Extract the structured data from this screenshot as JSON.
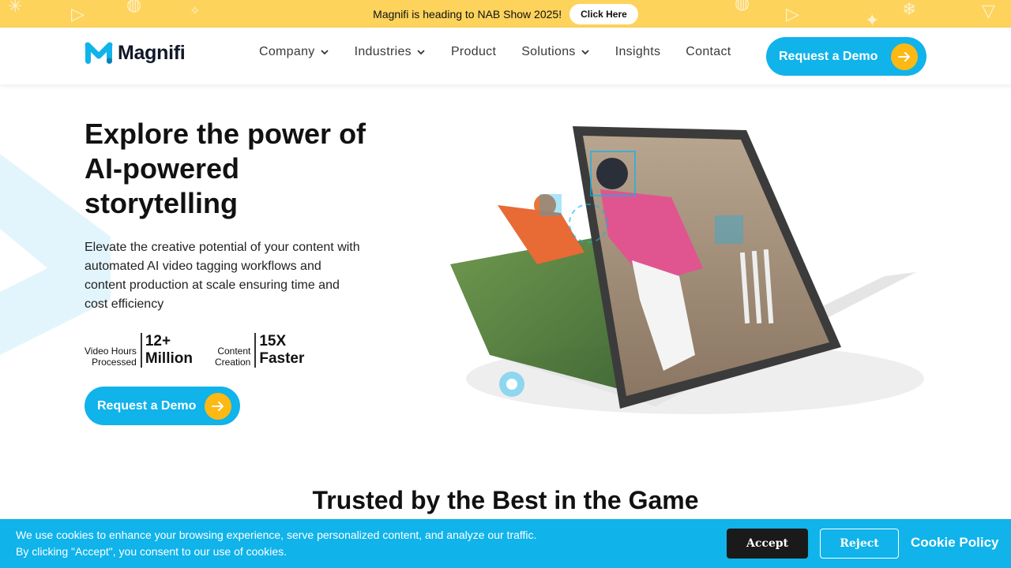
{
  "announcement": {
    "text": "Magnifi is heading to NAB Show 2025!",
    "button_label": "Click Here"
  },
  "header": {
    "logo_text": "Magnifi",
    "nav": [
      {
        "label": "Company",
        "has_dropdown": true
      },
      {
        "label": "Industries",
        "has_dropdown": true
      },
      {
        "label": "Product",
        "has_dropdown": false
      },
      {
        "label": "Solutions",
        "has_dropdown": true
      },
      {
        "label": "Insights",
        "has_dropdown": false
      },
      {
        "label": "Contact",
        "has_dropdown": false
      }
    ],
    "cta_label": "Request a Demo"
  },
  "hero": {
    "title_lines": [
      "Explore the power of",
      "AI-powered",
      "storytelling"
    ],
    "description": "Elevate the creative potential of your content with automated AI video tagging workflows and content production at scale ensuring time and cost efficiency",
    "stats": [
      {
        "label_lines": [
          "Video Hours",
          "Processed"
        ],
        "value_lines": [
          "12+",
          "Million"
        ]
      },
      {
        "label_lines": [
          "Content",
          "Creation"
        ],
        "value_lines": [
          "15X",
          "Faster"
        ]
      }
    ],
    "cta_label": "Request a Demo"
  },
  "trusted_heading": "Trusted by the Best in the Game",
  "cookie": {
    "line1": "We use cookies to enhance your browsing experience, serve personalized content, and analyze our traffic.",
    "line2": "By clicking \"Accept\", you consent to our use of cookies.",
    "accept_label": "Accept",
    "reject_label": "Reject",
    "policy_label": "Cookie Policy"
  },
  "colors": {
    "accent_blue": "#10b3ea",
    "accent_yellow": "#fdb913",
    "banner_yellow": "#fdd35c"
  }
}
